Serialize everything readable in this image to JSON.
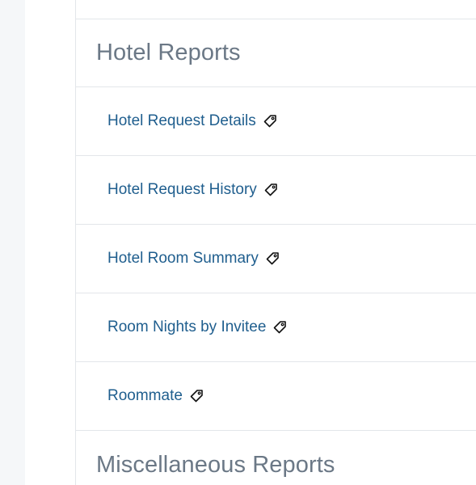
{
  "sections": [
    {
      "title": "Hotel Reports",
      "reports": [
        {
          "label": "Hotel Request Details",
          "icon": "tag-icon"
        },
        {
          "label": "Hotel Request History",
          "icon": "tag-icon"
        },
        {
          "label": "Hotel Room Summary",
          "icon": "tag-icon"
        },
        {
          "label": "Room Nights by Invitee",
          "icon": "tag-icon"
        },
        {
          "label": "Roommate",
          "icon": "tag-icon"
        }
      ]
    },
    {
      "title": "Miscellaneous Reports",
      "reports": []
    }
  ],
  "colors": {
    "link": "#1f5e8e",
    "section_title": "#6b7886",
    "divider": "#e3e6ea",
    "left_rail": "#f5f7f9"
  }
}
